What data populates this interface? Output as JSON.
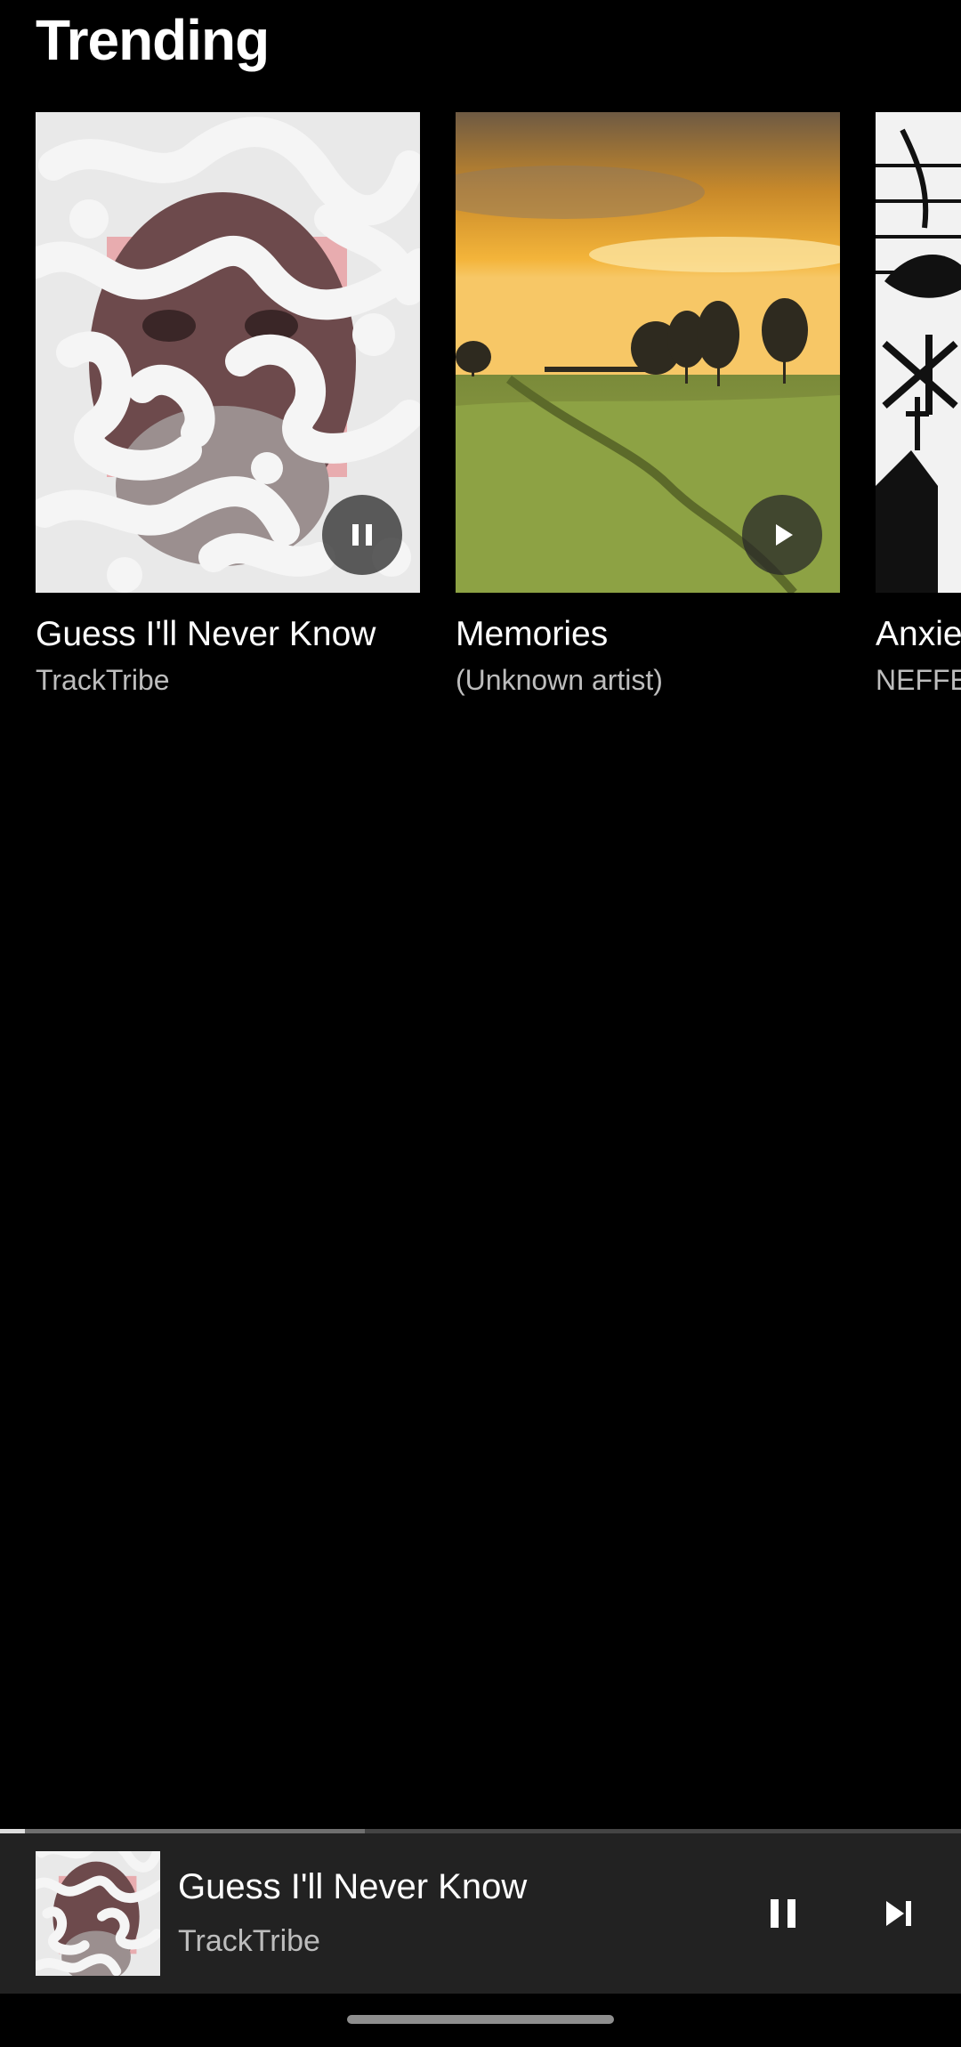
{
  "header": {
    "title": "Trending"
  },
  "cards": [
    {
      "title": "Guess I'll Never Know",
      "artist": "TrackTribe",
      "button_icon": "pause-icon"
    },
    {
      "title": "Memories",
      "artist": "(Unknown artist)",
      "button_icon": "play-icon"
    },
    {
      "title": "Anxie",
      "artist": "NEFFE",
      "button_icon": "play-icon"
    }
  ],
  "now_playing": {
    "title": "Guess I'll Never Know",
    "artist": "TrackTribe",
    "progress": 0.38
  },
  "colors": {
    "background": "#000000",
    "mini_player": "#222222",
    "secondary_text": "#bdbdbd",
    "accent_pink": "#e8959c"
  }
}
